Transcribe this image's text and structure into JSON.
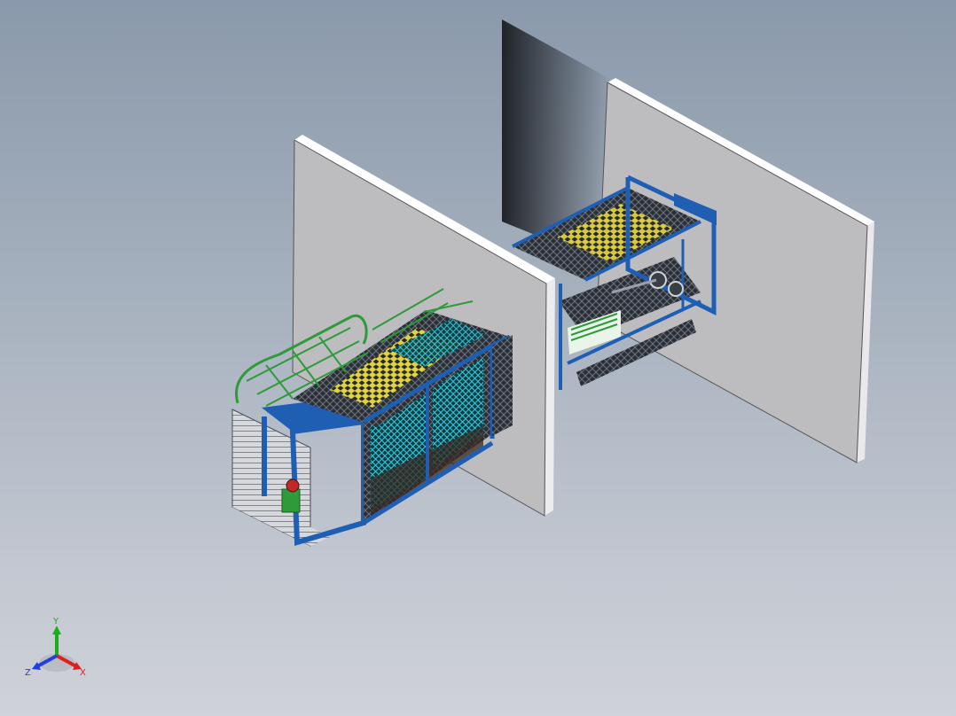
{
  "viewport": {
    "background_top": "#8a99ab",
    "background_bottom": "#cfd2d8"
  },
  "model": {
    "wall_color": "#b9b9bc",
    "wall_edge_color": "#ffffff",
    "frame_color": "#1f5fb3",
    "mesh_color": "#3b3b3b",
    "accent_yellow": "#f4e23a",
    "accent_cyan": "#2ad0e0",
    "guard_green": "#2f9a3a"
  },
  "triad": {
    "x_label": "X",
    "y_label": "Y",
    "z_label": "Z",
    "x_color": "#e02020",
    "y_color": "#18b018",
    "z_color": "#2040e0"
  }
}
